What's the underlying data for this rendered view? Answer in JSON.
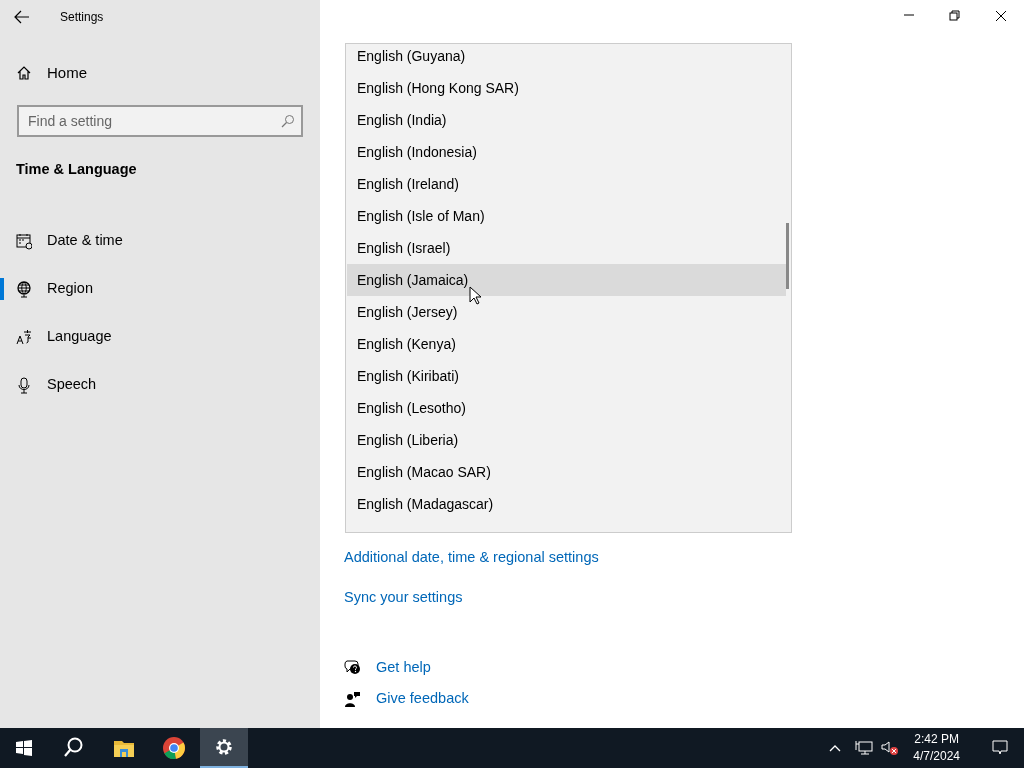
{
  "window": {
    "title": "Settings"
  },
  "sidebar": {
    "home": "Home",
    "search": {
      "placeholder": "Find a setting"
    },
    "section": "Time & Language",
    "items": [
      {
        "label": "Date & time",
        "kind": "calendar",
        "selected": false
      },
      {
        "label": "Region",
        "kind": "globe",
        "selected": true
      },
      {
        "label": "Language",
        "kind": "language",
        "selected": false
      },
      {
        "label": "Speech",
        "kind": "microphone",
        "selected": false
      }
    ]
  },
  "dropdown": {
    "items": [
      {
        "label": "English (Guyana)",
        "hovered": false
      },
      {
        "label": "English (Hong Kong SAR)",
        "hovered": false
      },
      {
        "label": "English (India)",
        "hovered": false
      },
      {
        "label": "English (Indonesia)",
        "hovered": false
      },
      {
        "label": "English (Ireland)",
        "hovered": false
      },
      {
        "label": "English (Isle of Man)",
        "hovered": false
      },
      {
        "label": "English (Israel)",
        "hovered": false
      },
      {
        "label": "English (Jamaica)",
        "hovered": true
      },
      {
        "label": "English (Jersey)",
        "hovered": false
      },
      {
        "label": "English (Kenya)",
        "hovered": false
      },
      {
        "label": "English (Kiribati)",
        "hovered": false
      },
      {
        "label": "English (Lesotho)",
        "hovered": false
      },
      {
        "label": "English (Liberia)",
        "hovered": false
      },
      {
        "label": "English (Macao SAR)",
        "hovered": false
      },
      {
        "label": "English (Madagascar)",
        "hovered": false
      }
    ]
  },
  "related_links": [
    "Additional date, time & regional settings",
    "Sync your settings"
  ],
  "help_links": [
    {
      "label": "Get help",
      "kind": "help"
    },
    {
      "label": "Give feedback",
      "kind": "feedback"
    }
  ],
  "taskbar": {
    "apps": [
      {
        "kind": "search",
        "active": false
      },
      {
        "kind": "explorer",
        "active": false
      },
      {
        "kind": "browser",
        "active": false
      },
      {
        "kind": "settings",
        "active": true
      }
    ],
    "time": "2:42 PM",
    "date": "4/7/2024"
  }
}
